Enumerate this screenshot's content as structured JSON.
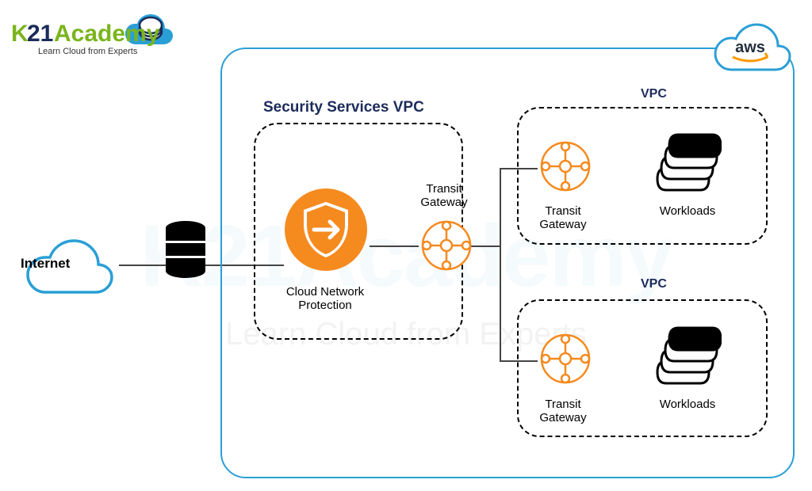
{
  "brand": {
    "name_k": "K",
    "name_21": "21",
    "name_academy": "Academy",
    "tagline": "Learn Cloud from Experts"
  },
  "watermark": "K21Academy",
  "watermark_sub": "Learn Cloud from Experts",
  "cloud_provider": "aws",
  "nodes": {
    "internet": "Internet",
    "database": "database-icon",
    "security_vpc_title": "Security Services VPC",
    "cloud_net_protection": "Cloud Network Protection",
    "transit_gateway": "Transit Gateway",
    "vpc": "VPC",
    "workloads": "Workloads"
  },
  "colors": {
    "border_blue": "#2a9fd6",
    "navy": "#1b2b5a",
    "orange": "#f58a1f",
    "aws_orange": "#ff9900"
  }
}
